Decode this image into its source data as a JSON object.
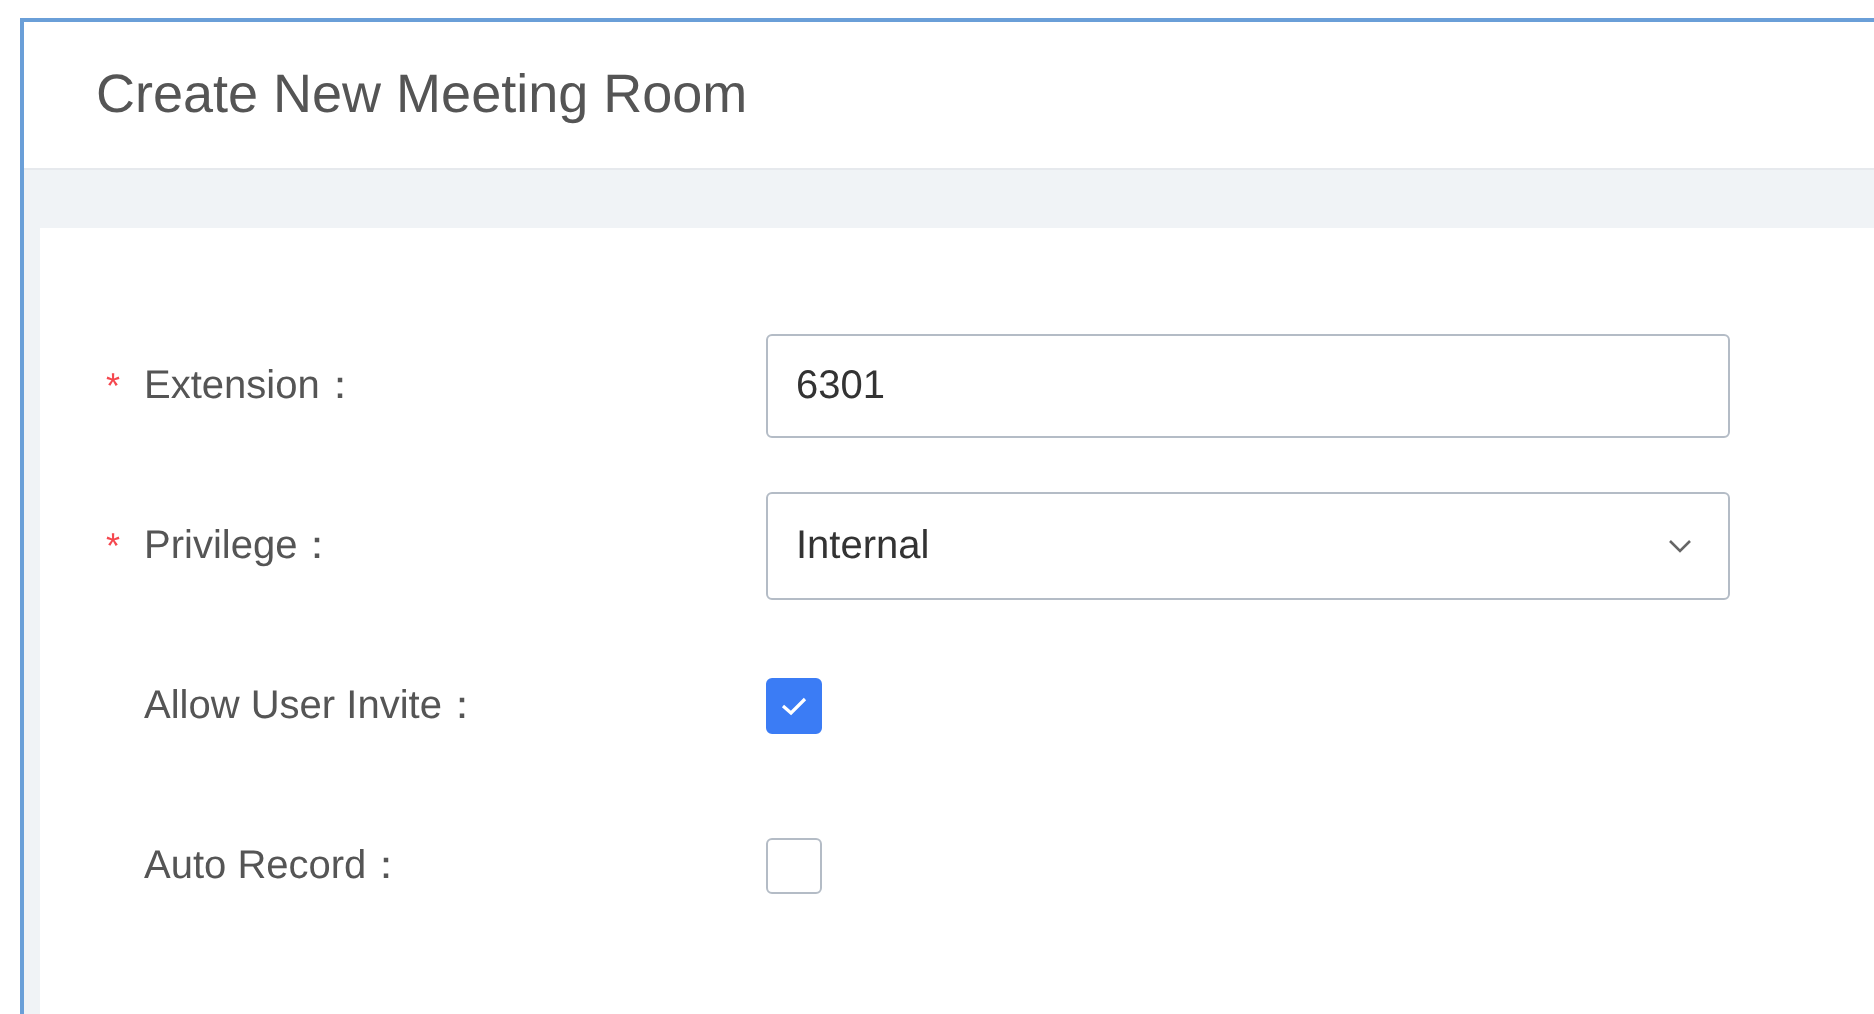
{
  "window": {
    "title": "Create New Meeting Room"
  },
  "fields": [
    {
      "kind": "text",
      "marker": "*",
      "label": "Extension：",
      "value": "6301"
    },
    {
      "kind": "select",
      "marker": "*",
      "label": "Privilege：",
      "value": "Internal"
    },
    {
      "kind": "checkbox",
      "label": "Allow User Invite：",
      "checked": true
    },
    {
      "kind": "checkbox",
      "label": "Auto Record：",
      "checked": false
    }
  ]
}
